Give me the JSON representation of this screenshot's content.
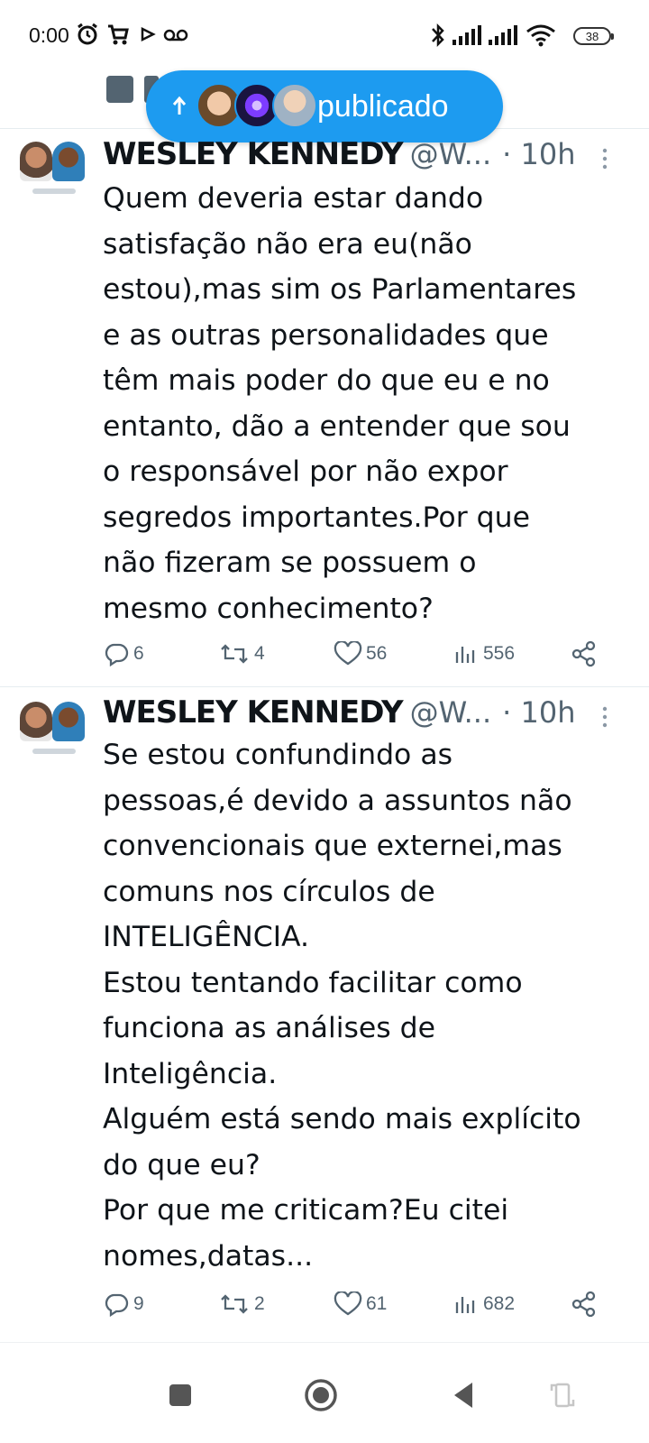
{
  "status_bar": {
    "time": "0:00",
    "battery": "38"
  },
  "banner": {
    "label": "publicado"
  },
  "tweets": [
    {
      "name": "WESLEY KENNEDY",
      "handle": "@W...",
      "time": "· 10h",
      "lines": [
        "Quem deveria estar dando",
        "satisfação não era eu(não",
        "estou),mas sim os Parlamentares",
        "e as outras personalidades que",
        "têm mais poder do que eu e no",
        "entanto, dão a entender que sou",
        "o responsável por não expor",
        "segredos importantes.Por que",
        "não fizeram se possuem o",
        "mesmo conhecimento?"
      ],
      "replies": "6",
      "retweets": "4",
      "likes": "56",
      "views": "556"
    },
    {
      "name": "WESLEY KENNEDY",
      "handle": "@W...",
      "time": "· 10h",
      "lines": [
        "Se estou confundindo as",
        "pessoas,é devido a assuntos não",
        "convencionais que externei,mas",
        "comuns nos círculos de",
        "INTELIGÊNCIA.",
        "Estou tentando facilitar como",
        "funciona as análises de",
        "Inteligência.",
        "Alguém está sendo mais explícito",
        "do que eu?",
        "Por que me criticam?Eu citei",
        "nomes,datas..."
      ],
      "replies": "9",
      "retweets": "2",
      "likes": "61",
      "views": "682"
    }
  ],
  "icons": {
    "alarm": "alarm-icon",
    "cart": "cart-icon",
    "play": "play-icon",
    "voicemail": "voicemail-icon",
    "bluetooth": "bluetooth-icon",
    "signal": "signal-icon",
    "wifi": "wifi-icon"
  },
  "colors": {
    "accent": "#1d9bf0",
    "text": "#0f1419",
    "secondary": "#536471"
  }
}
